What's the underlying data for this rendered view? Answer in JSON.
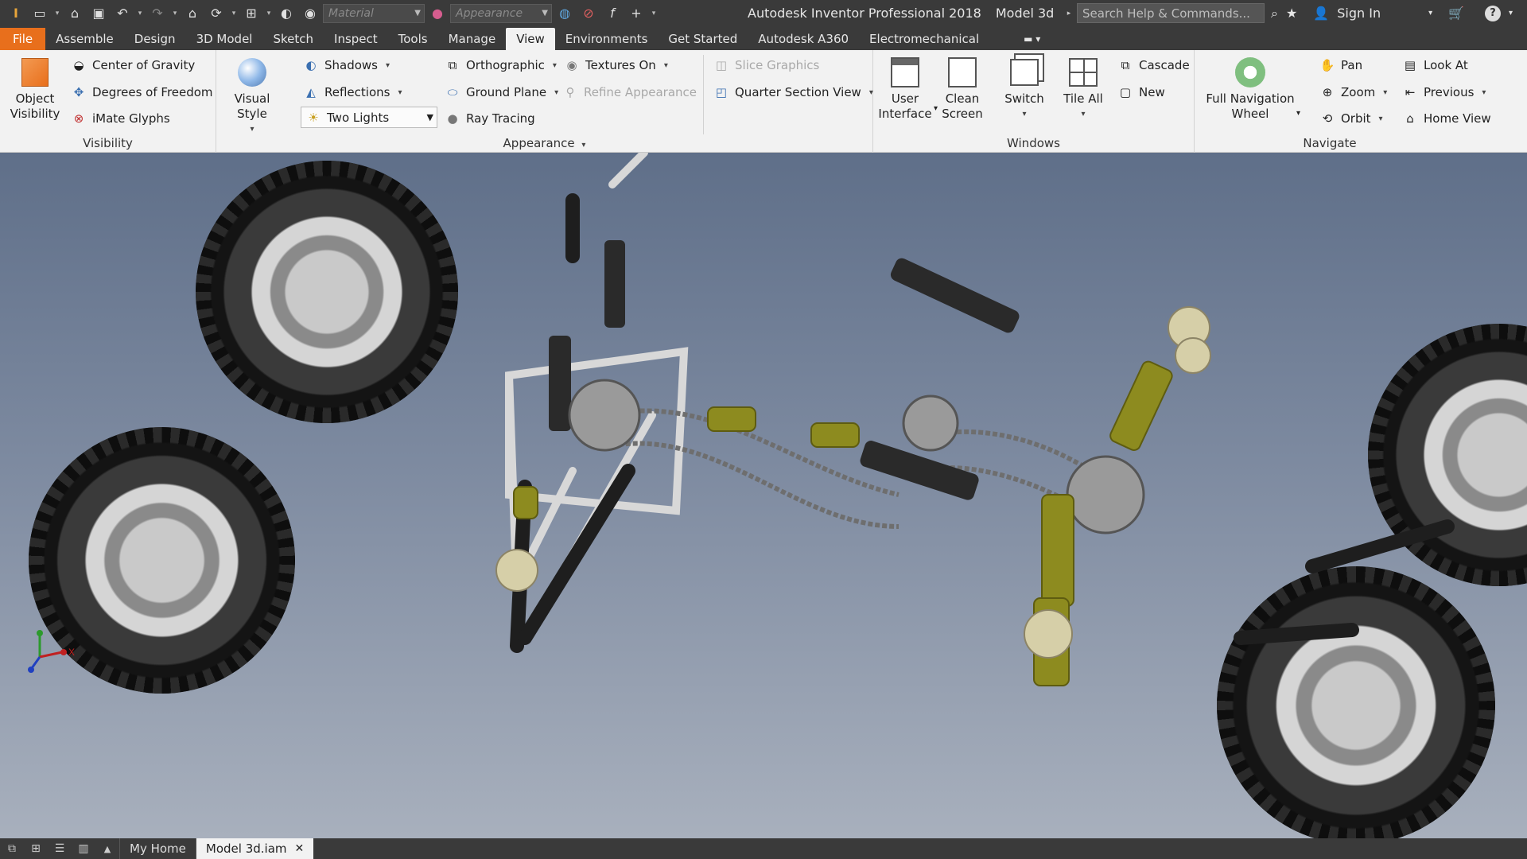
{
  "titlebar": {
    "material_placeholder": "Material",
    "appearance_placeholder": "Appearance",
    "app_title": "Autodesk Inventor Professional 2018",
    "document_title": "Model 3d",
    "search_placeholder": "Search Help & Commands...",
    "sign_in": "Sign In"
  },
  "tabs": [
    "File",
    "Assemble",
    "Design",
    "3D Model",
    "Sketch",
    "Inspect",
    "Tools",
    "Manage",
    "View",
    "Environments",
    "Get Started",
    "Autodesk A360",
    "Electromechanical"
  ],
  "active_tab": "View",
  "ribbon": {
    "visibility": {
      "label": "Visibility",
      "object_visibility": "Object\nVisibility",
      "center_of_gravity": "Center of Gravity",
      "degrees_of_freedom": "Degrees of Freedom",
      "imate_glyphs": "iMate Glyphs"
    },
    "appearance": {
      "label": "Appearance",
      "visual_style": "Visual Style",
      "shadows": "Shadows",
      "reflections": "Reflections",
      "lighting_style": "Two Lights",
      "orthographic": "Orthographic",
      "ground_plane": "Ground Plane",
      "ray_tracing": "Ray Tracing",
      "textures_on": "Textures On",
      "refine_appearance": "Refine Appearance",
      "slice_graphics": "Slice Graphics",
      "quarter_section_view": "Quarter Section View"
    },
    "windows": {
      "label": "Windows",
      "user_interface": "User\nInterface",
      "clean_screen": "Clean\nScreen",
      "switch": "Switch",
      "tile_all": "Tile All",
      "cascade": "Cascade",
      "new": "New"
    },
    "navigate": {
      "label": "Navigate",
      "full_navigation_wheel": "Full Navigation\nWheel",
      "pan": "Pan",
      "zoom": "Zoom",
      "orbit": "Orbit",
      "look_at": "Look At",
      "previous": "Previous",
      "home_view": "Home View"
    }
  },
  "triad": {
    "x_label": "X"
  },
  "doctabs": {
    "home": "My Home",
    "document": "Model 3d.iam"
  },
  "colors": {
    "file_tab": "#e86f1c",
    "chrome": "#3a3a3a",
    "ribbon": "#f2f2f2"
  }
}
